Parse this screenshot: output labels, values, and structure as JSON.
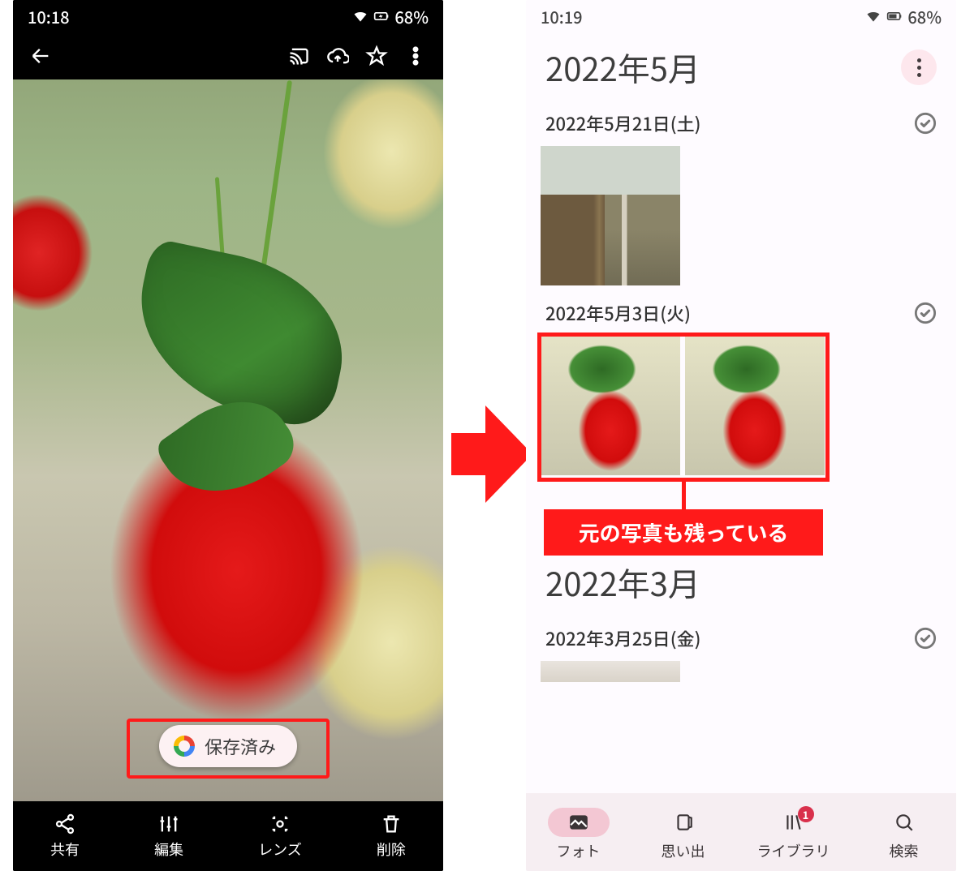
{
  "left": {
    "status": {
      "time": "10:18",
      "battery": "68%"
    },
    "toast": "保存済み",
    "actions": {
      "share": "共有",
      "edit": "編集",
      "lens": "レンズ",
      "delete": "削除"
    }
  },
  "arrow_note": "→",
  "right": {
    "status": {
      "time": "10:19",
      "battery": "68%"
    },
    "month1": "2022年5月",
    "sections": [
      {
        "date": "2022年5月21日(土)"
      },
      {
        "date": "2022年5月3日(火)"
      }
    ],
    "annotation": "元の写真も残っている",
    "month2": "2022年3月",
    "section3_date": "2022年3月25日(金)",
    "nav": {
      "photos": "フォト",
      "memories": "思い出",
      "library": "ライブラリ",
      "search": "検索",
      "library_badge": "1"
    }
  }
}
